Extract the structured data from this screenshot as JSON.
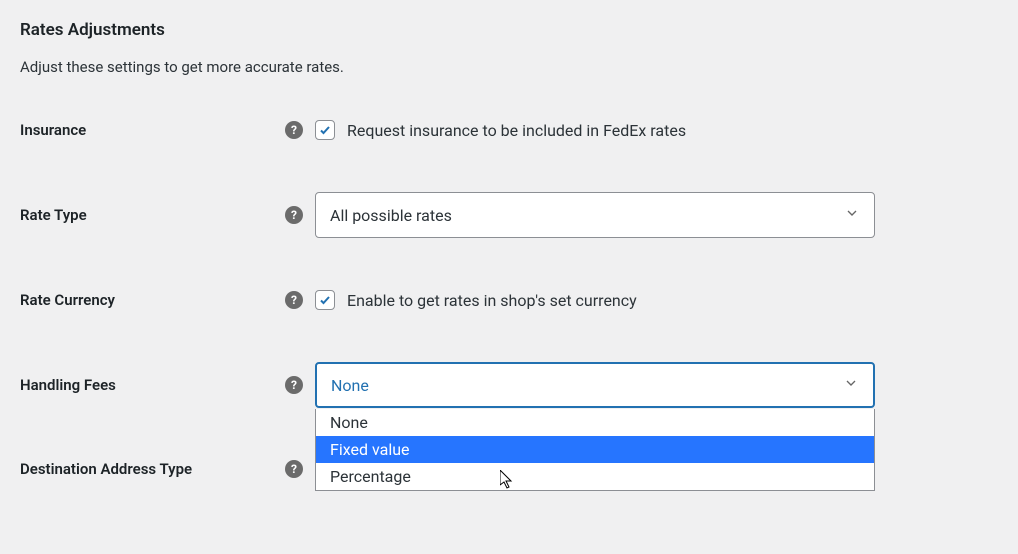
{
  "heading": "Rates Adjustments",
  "description": "Adjust these settings to get more accurate rates.",
  "fields": {
    "insurance": {
      "label": "Insurance",
      "checkbox_label": "Request insurance to be included in FedEx rates",
      "checked": true
    },
    "rate_type": {
      "label": "Rate Type",
      "selected": "All possible rates"
    },
    "rate_currency": {
      "label": "Rate Currency",
      "checkbox_label": "Enable to get rates in shop's set currency",
      "checked": true
    },
    "handling_fees": {
      "label": "Handling Fees",
      "selected": "None",
      "options": [
        "None",
        "Fixed value",
        "Percentage"
      ],
      "highlighted_index": 1
    },
    "destination_address_type": {
      "label": "Destination Address Type"
    }
  }
}
